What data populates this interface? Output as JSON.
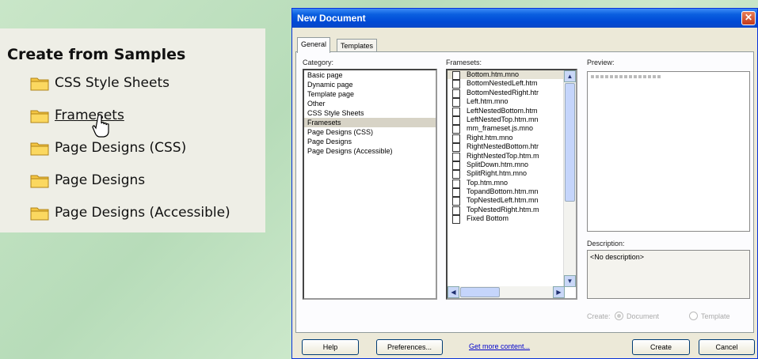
{
  "samples": {
    "title": "Create from Samples",
    "items": [
      {
        "label": "CSS Style Sheets"
      },
      {
        "label": "Framesets"
      },
      {
        "label": "Page Designs (CSS)"
      },
      {
        "label": "Page Designs"
      },
      {
        "label": "Page Designs (Accessible)"
      }
    ]
  },
  "dialog": {
    "title": "New Document",
    "close_glyph": "✕",
    "tabs": [
      {
        "label": "General"
      },
      {
        "label": "Templates"
      }
    ],
    "category_label": "Category:",
    "categories": [
      "Basic page",
      "Dynamic page",
      "Template page",
      "Other",
      "CSS Style Sheets",
      "Framesets",
      "Page Designs (CSS)",
      "Page Designs",
      "Page Designs (Accessible)"
    ],
    "selected_category": "Framesets",
    "framesets_label": "Framesets:",
    "framesets": [
      "Bottom.htm.mno",
      "BottomNestedLeft.htm",
      "BottomNestedRight.htr",
      "Left.htm.mno",
      "LeftNestedBottom.htm",
      "LeftNestedTop.htm.mn",
      "mm_frameset.js.mno",
      "Right.htm.mno",
      "RightNestedBottom.htr",
      "RightNestedTop.htm.m",
      "SplitDown.htm.mno",
      "SplitRight.htm.mno",
      "Top.htm.mno",
      "TopandBottom.htm.mn",
      "TopNestedLeft.htm.mn",
      "TopNestedRight.htm.m",
      "Fixed Bottom"
    ],
    "preview_label": "Preview:",
    "description_label": "Description:",
    "description": "<No description>",
    "create_label": "Create:",
    "radio_document": "Document",
    "radio_template": "Template",
    "help": "Help",
    "preferences": "Preferences...",
    "get_more": "Get more content...",
    "create": "Create",
    "cancel": "Cancel"
  },
  "colors": {
    "titlebar": "#0a5fe0",
    "background": "#c9e6c8",
    "panel": "#eeeee6",
    "dialog": "#ece9d8"
  }
}
